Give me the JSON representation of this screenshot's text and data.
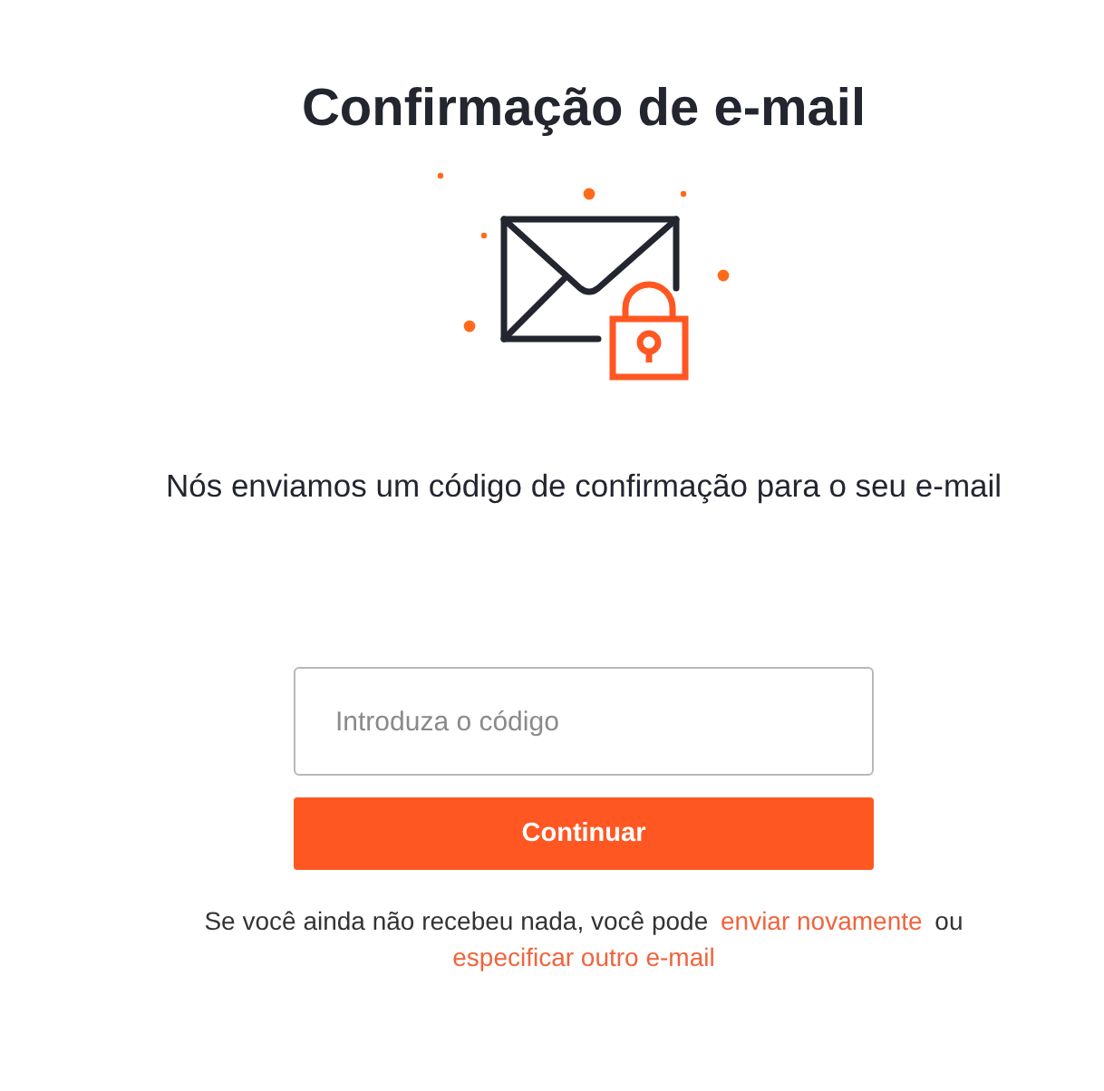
{
  "title": "Confirmação de e-mail",
  "message": "Nós enviamos um código de confirmação para o seu e-mail",
  "code_field": {
    "placeholder": "Introduza o código"
  },
  "continue_button": "Continuar",
  "footer": {
    "text_before": "Se você ainda não recebeu nada, você pode",
    "resend_link": "enviar novamente",
    "text_between": "ou",
    "other_email_link": "especificar outro e-mail"
  }
}
